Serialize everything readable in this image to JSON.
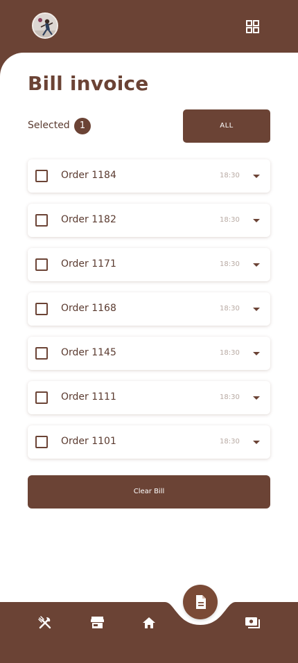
{
  "header": {
    "avatar_icon": "avatar-photo",
    "menu_icon": "grid-icon"
  },
  "page": {
    "title": "Bill invoice"
  },
  "selection": {
    "label": "Selected",
    "count": "1",
    "all_button": "ALL"
  },
  "orders": [
    {
      "label": "Order 1184",
      "time": "18:30",
      "checked": false
    },
    {
      "label": "Order 1182",
      "time": "18:30",
      "checked": false
    },
    {
      "label": "Order 1171",
      "time": "18:30",
      "checked": false
    },
    {
      "label": "Order 1168",
      "time": "18:30",
      "checked": false
    },
    {
      "label": "Order 1145",
      "time": "18:30",
      "checked": false
    },
    {
      "label": "Order 1111",
      "time": "18:30",
      "checked": false
    },
    {
      "label": "Order 1101",
      "time": "18:30",
      "checked": false
    }
  ],
  "actions": {
    "clear_bill": "Clear Bill"
  },
  "bottom_nav": {
    "items": [
      {
        "icon": "utensils-icon"
      },
      {
        "icon": "store-icon"
      },
      {
        "icon": "home-icon"
      },
      {
        "icon": "document-icon",
        "active": true
      },
      {
        "icon": "payment-icon"
      }
    ]
  },
  "colors": {
    "brand": "#6b4335",
    "accent": "#7a4a36",
    "background": "#ffffff",
    "muted_text": "#b8aaa3"
  }
}
